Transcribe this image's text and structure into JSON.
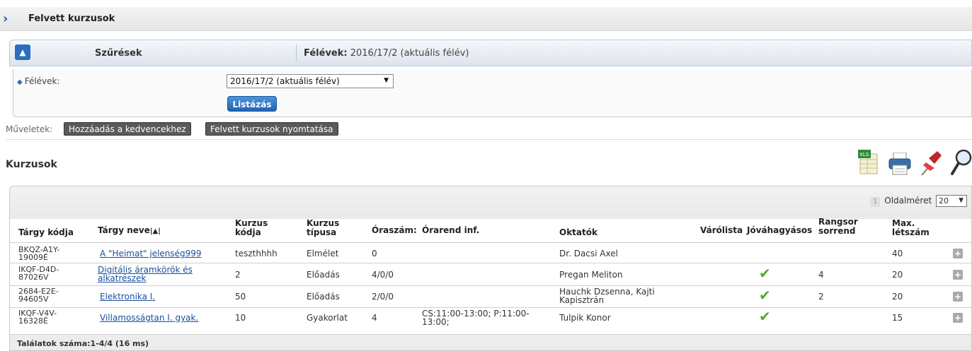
{
  "page": {
    "title": "Felvett kurzusok"
  },
  "filter": {
    "header_label": "Szűrések",
    "summary_label": "Félévek:",
    "summary_value": "2016/17/2 (aktuális félév)",
    "field_label": "Félévek:",
    "select_value": "2016/17/2 (aktuális félév)",
    "list_button": "Listázás"
  },
  "operations": {
    "label": "Műveletek:",
    "add_favorite": "Hozzáadás a kedvencekhez",
    "print": "Felvett kurzusok nyomtatása"
  },
  "section": {
    "title": "Kurzusok"
  },
  "toolbar_icons": [
    "excel-export-icon",
    "print-icon",
    "pin-icon",
    "search-icon"
  ],
  "pager": {
    "current_page": "1",
    "page_size_label": "Oldalméret",
    "page_size": "20"
  },
  "table": {
    "headers": {
      "code": "Tárgy kódja",
      "name": "Tárgy neve",
      "sort_indicator": "|▲|",
      "course_code": "Kurzus kódja",
      "course_type": "Kurzus típusa",
      "hours": "Óraszám:",
      "timetable": "Órarend inf.",
      "teachers": "Oktatók",
      "waitlist": "Várólista",
      "approval": "Jóváhagyásos",
      "rank": "Rangsor sorrend",
      "max": "Max. létszám"
    },
    "rows": [
      {
        "code": "BKQZ-A1Y-19009É",
        "name": "A \"Heimat\" jelenség999",
        "course_code": "teszthhhh",
        "type": "Elmélet",
        "hours": "0",
        "timetable": "",
        "teachers": "Dr. Dacsi Axel",
        "approval": false,
        "rank": "",
        "max": "40"
      },
      {
        "code": "IKQF-D4D-87026V",
        "name": "Digitális áramkörök és alkatrészek",
        "course_code": "2",
        "type": "Előadás",
        "hours": "4/0/0",
        "timetable": "",
        "teachers": "Pregan Meliton",
        "approval": true,
        "rank": "4",
        "max": "20"
      },
      {
        "code": "2684-E2E-94605V",
        "name": "Elektronika I.",
        "course_code": "50",
        "type": "Előadás",
        "hours": "2/0/0",
        "timetable": "",
        "teachers": "Hauchk Dzsenna, Kajti Kapisztrán",
        "approval": true,
        "rank": "2",
        "max": "20"
      },
      {
        "code": "IKQF-V4V-16328É",
        "name": "Villamosságtan I. gyak.",
        "course_code": "10",
        "type": "Gyakorlat",
        "hours": "4",
        "timetable": "CS:11:00-13:00; P:11:00-13:00;",
        "teachers": "Tulpik Konor",
        "approval": true,
        "rank": "",
        "max": "15"
      }
    ]
  },
  "footer": {
    "results": "Találatok száma:1-4/4 (16 ms)"
  },
  "colors": {
    "accent": "#2a6fbd",
    "link": "#1a4f9c",
    "check": "#4cad2a"
  }
}
